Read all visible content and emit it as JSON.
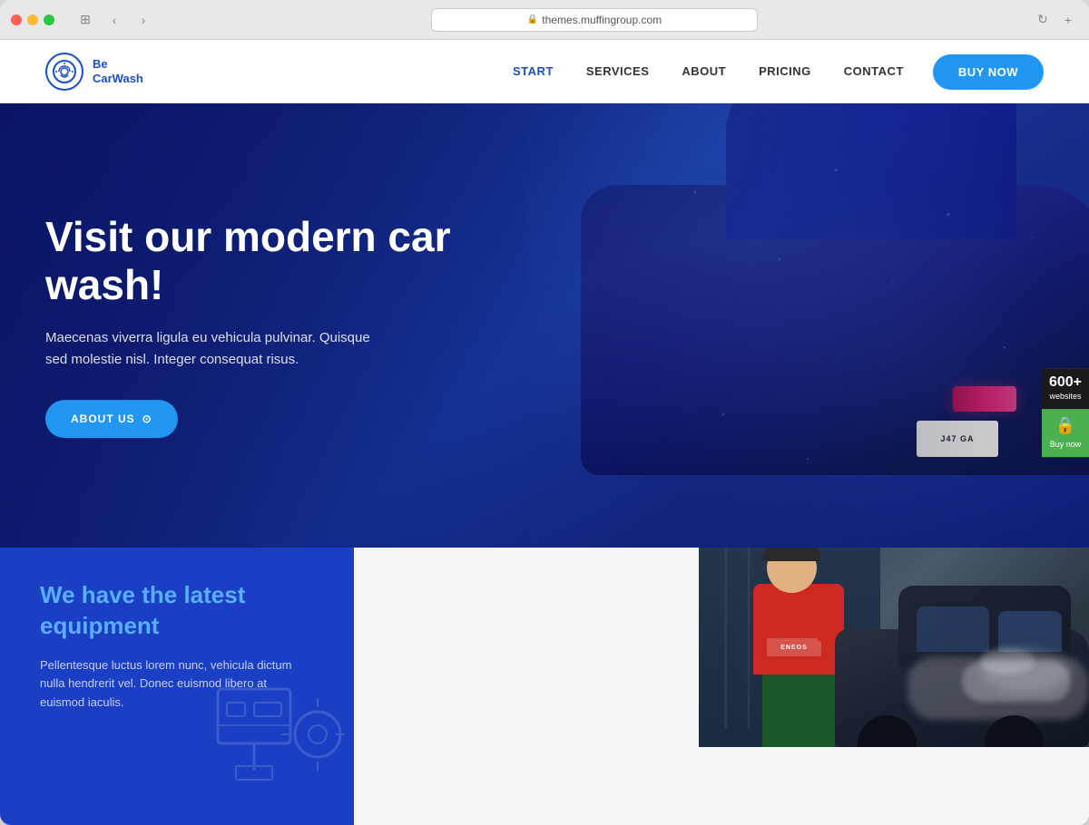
{
  "browser": {
    "url": "themes.muffingroup.com",
    "back_label": "‹",
    "forward_label": "›",
    "refresh_label": "↻",
    "new_tab_label": "+"
  },
  "navbar": {
    "logo_line1": "Be",
    "logo_line2": "CarWash",
    "nav_links": [
      {
        "label": "START",
        "active": true
      },
      {
        "label": "SERVICES",
        "active": false
      },
      {
        "label": "ABOUT",
        "active": false
      },
      {
        "label": "PRICING",
        "active": false
      },
      {
        "label": "CONTACT",
        "active": false
      }
    ],
    "buy_now_label": "BUY NOW"
  },
  "hero": {
    "title": "Visit our modern car wash!",
    "subtitle": "Maecenas viverra ligula eu vehicula pulvinar. Quisque sed molestie nisl. Integer consequat risus.",
    "about_btn_label": "ABOUT US",
    "license_plate_text": "J47 GA"
  },
  "bottom": {
    "equipment_title": "We have the latest equipment",
    "equipment_text": "Pellentesque luctus lorem nunc, vehicula dictum nulla hendrerit vel. Donec euismod libero at euismod iaculis."
  },
  "sidebar_widgets": [
    {
      "type": "dark",
      "count": "600+",
      "label": "websites"
    },
    {
      "type": "green",
      "icon": "🔒",
      "label": "Buy now"
    }
  ]
}
